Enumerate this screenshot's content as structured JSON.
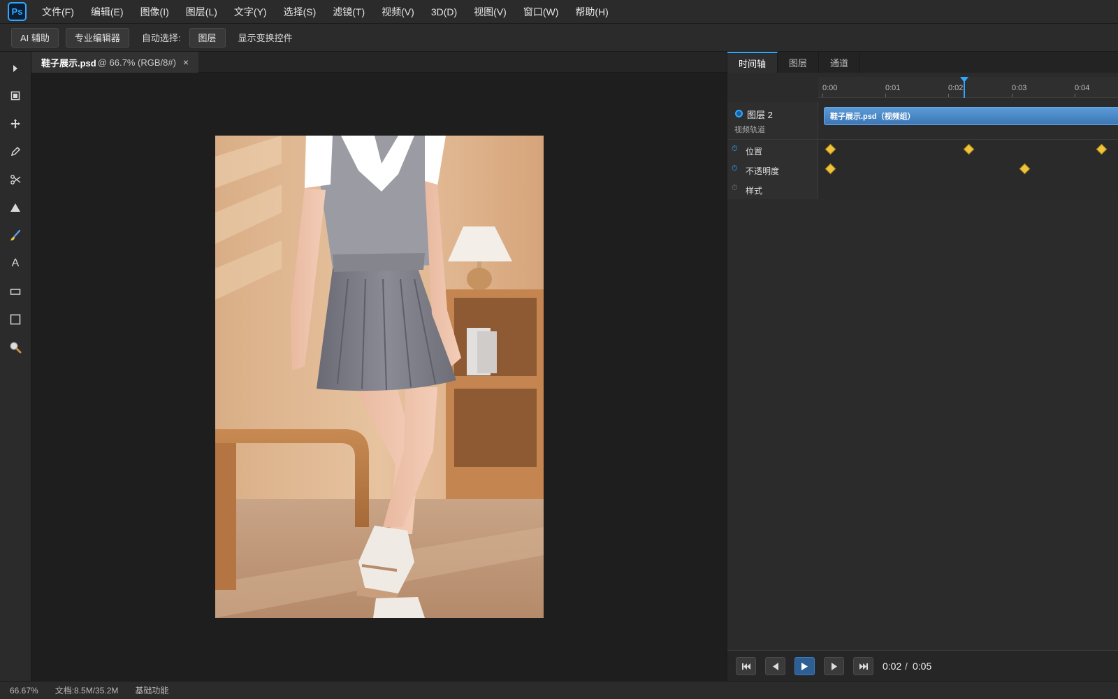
{
  "app": {
    "logo": "Ps"
  },
  "menu": [
    "文件(F)",
    "编辑(E)",
    "图像(I)",
    "图层(L)",
    "文字(Y)",
    "选择(S)",
    "滤镜(T)",
    "视频(V)",
    "3D(D)",
    "视图(V)",
    "窗口(W)",
    "帮助(H)"
  ],
  "options": {
    "ai_button": "AI 辅助",
    "pro_editor_button": "专业编辑器",
    "auto_select_label": "自动选择:",
    "layer_button": "图层",
    "show_transform_label": "显示变换控件"
  },
  "tools": [
    "arrow-icon",
    "artboard-icon",
    "move-icon",
    "pen-icon",
    "crop-icon",
    "shape-icon",
    "brush-icon",
    "text-icon",
    "rectangle-icon",
    "marquee-icon",
    "zoom-icon"
  ],
  "document": {
    "name": "鞋子展示.psd",
    "info": "@ 66.7% (RGB/8#)",
    "close": "×"
  },
  "panel": {
    "tabs": [
      "时间轴",
      "图层",
      "通道"
    ],
    "active_tab": "时间轴"
  },
  "timeline": {
    "ticks": [
      "0:00",
      "0:01",
      "0:02",
      "0:03",
      "0:04"
    ],
    "playhead": 0.023,
    "track": {
      "name": "图层 2",
      "type": "视频轨道",
      "clip": "鞋子展示.psd（视频组）"
    },
    "properties": [
      {
        "label": "位置",
        "active": true,
        "keyframes": [
          0,
          2.2,
          4.3
        ]
      },
      {
        "label": "不透明度",
        "active": true,
        "keyframes": [
          0,
          3.1
        ]
      },
      {
        "label": "样式",
        "active": false,
        "keyframes": []
      }
    ],
    "transport": {
      "current": "0:02",
      "separator": "/",
      "total": "0:05"
    }
  },
  "status": {
    "zoom": "66.67%",
    "doc": "文档:8.5M/35.2M",
    "workspace": "基础功能"
  },
  "colors": {
    "accent": "#31a8ff",
    "keyframe": "#f0c43a",
    "clip": "#3d77b5"
  }
}
